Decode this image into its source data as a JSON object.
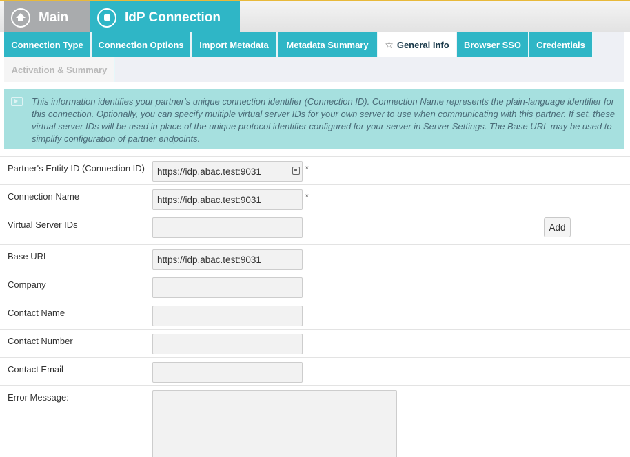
{
  "header": {
    "main_label": "Main",
    "main_icon": "home-icon",
    "idp_label": "IdP Connection",
    "idp_icon": "connection-icon"
  },
  "tabs": [
    {
      "label": "Connection Type",
      "state": "normal"
    },
    {
      "label": "Connection Options",
      "state": "normal"
    },
    {
      "label": "Import Metadata",
      "state": "normal"
    },
    {
      "label": "Metadata Summary",
      "state": "normal"
    },
    {
      "label": "General Info",
      "state": "active",
      "icon": "star-icon"
    },
    {
      "label": "Browser SSO",
      "state": "normal"
    },
    {
      "label": "Credentials",
      "state": "normal"
    },
    {
      "label": "Activation & Summary",
      "state": "disabled"
    }
  ],
  "info": {
    "text": "This information identifies your partner's unique connection identifier (Connection ID). Connection Name represents the plain-language identifier for this connection. Optionally, you can specify multiple virtual server IDs for your own server to use when communicating with this partner. If set, these virtual server IDs will be used in place of the unique protocol identifier configured for your server in Server Settings. The Base URL may be used to simplify configuration of partner endpoints."
  },
  "form": {
    "entity_id": {
      "label": "Partner's Entity ID (Connection ID)",
      "value": "https://idp.abac.test:9031",
      "required": "*"
    },
    "connection_name": {
      "label": "Connection Name",
      "value": "https://idp.abac.test:9031",
      "required": "*"
    },
    "virtual_server_ids": {
      "label": "Virtual Server IDs",
      "value": "",
      "add_label": "Add"
    },
    "base_url": {
      "label": "Base URL",
      "value": "https://idp.abac.test:9031"
    },
    "company": {
      "label": "Company",
      "value": ""
    },
    "contact_name": {
      "label": "Contact Name",
      "value": ""
    },
    "contact_number": {
      "label": "Contact Number",
      "value": ""
    },
    "contact_email": {
      "label": "Contact Email",
      "value": ""
    },
    "error_message": {
      "label": "Error Message:",
      "value": ""
    }
  },
  "colors": {
    "accent": "#2fb6c6",
    "main_tab": "#a9abad",
    "info_bg": "#a6e0df",
    "active_tab_text": "#1b3a4b"
  }
}
